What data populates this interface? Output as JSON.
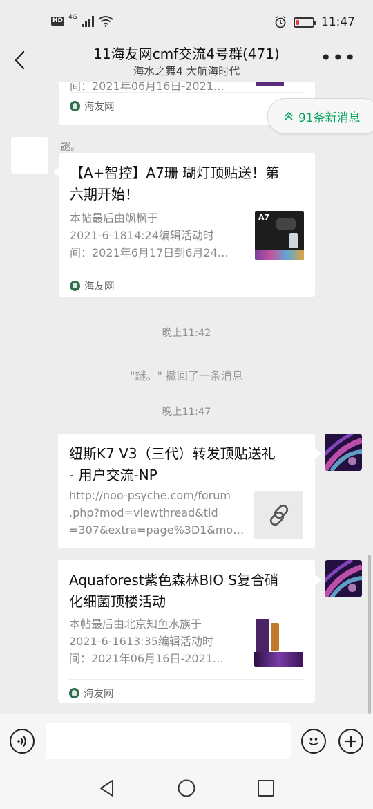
{
  "status_bar": {
    "hd": "HD",
    "network": "4G",
    "time": "11:47",
    "battery_percent": 15
  },
  "header": {
    "title": "11海友网cmf交流4号群(471)",
    "subtitle": "海水之舞4 大航海时代"
  },
  "new_messages": {
    "label": "91条新消息"
  },
  "messages": [
    {
      "partial_desc": "间：2021年06月16日-2021…",
      "source": "海友网"
    },
    {
      "sender": "謎。",
      "title_line1": "【A+智控】A7珊 瑚灯顶贴送！第",
      "title_line2": "六期开始！",
      "desc_line1": "本帖最后由飒枫于",
      "desc_line2": "2021-6-1814:24编辑活动时",
      "desc_line3": "间：2021年6月17日到6月24…",
      "source": "海友网"
    },
    {
      "timestamp": "晚上11:42",
      "recall": "\"謎。\" 撤回了一条消息"
    },
    {
      "timestamp": "晚上11:47"
    },
    {
      "title_line1": "纽斯K7 V3（三代）转发顶贴送礼",
      "title_line2": "- 用户交流-NP",
      "desc_line1": "http://noo-psyche.com/forum",
      "desc_line2": ".php?mod=viewthread&tid",
      "desc_line3": "=307&extra=page%3D1&mo…"
    },
    {
      "title_line1": "Aquaforest紫色森林BIO S复合硝",
      "title_line2": "化细菌顶楼活动",
      "desc_line1": "本帖最后由北京知鱼水族于",
      "desc_line2": "2021-6-1613:35编辑活动时",
      "desc_line3": "间：2021年06月16日-2021…",
      "source": "海友网"
    }
  ],
  "thumb_a7": {
    "label": "A7"
  },
  "colors": {
    "accent_green": "#07a55e",
    "background": "#ededed",
    "bubble": "#ffffff"
  },
  "icons": [
    "back-arrow-icon",
    "more-icon",
    "double-chevron-up-icon",
    "link-icon",
    "voice-icon",
    "emoji-icon",
    "plus-icon",
    "nav-back-icon",
    "nav-home-icon",
    "nav-recents-icon",
    "wifi-icon",
    "signal-icon",
    "alarm-icon",
    "battery-icon"
  ]
}
